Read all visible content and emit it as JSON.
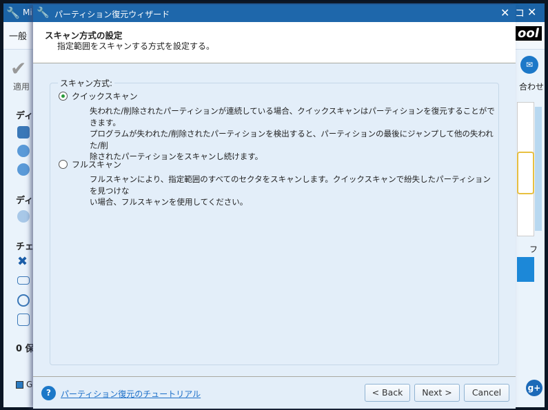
{
  "app": {
    "title": "Mi",
    "menu_first": "一般",
    "apply_label": "適用",
    "contact_label": "合わせ",
    "brand_fragment": "ool",
    "side_headings": [
      "ディ",
      "ディ",
      "チェ"
    ],
    "pending": "0 保",
    "legend": "G",
    "right_col_label": "フ"
  },
  "dialog": {
    "title": "パーティション復元ウィザード",
    "header_title": "スキャン方式の設定",
    "header_subtitle": "指定範囲をスキャンする方式を設定する。",
    "group_label": "スキャン方式:",
    "options": [
      {
        "label": "クイックスキャン",
        "selected": true,
        "desc": [
          "失われた/削除されたパーティションが連続している場合、クイックスキャンはパーティションを復元することができます。",
          "プログラムが失われた/削除されたパーティションを検出すると、パーティションの最後にジャンプして他の失われた/削",
          "除されたパーティションをスキャンし続けます。"
        ]
      },
      {
        "label": "フルスキャン",
        "selected": false,
        "desc": [
          "フルスキャンにより、指定範囲のすべてのセクタをスキャンします。クイックスキャンで紛失したパーティションを見つけな",
          "い場合、フルスキャンを使用してください。"
        ]
      }
    ],
    "tutorial_link": "パーティション復元のチュートリアル",
    "back_label": "< Back",
    "next_label": "Next >",
    "cancel_label": "Cancel"
  },
  "colors": {
    "titlebar": "#1e67ab",
    "body": "#e3eef9",
    "selected_radio": "#2a9a3a"
  }
}
